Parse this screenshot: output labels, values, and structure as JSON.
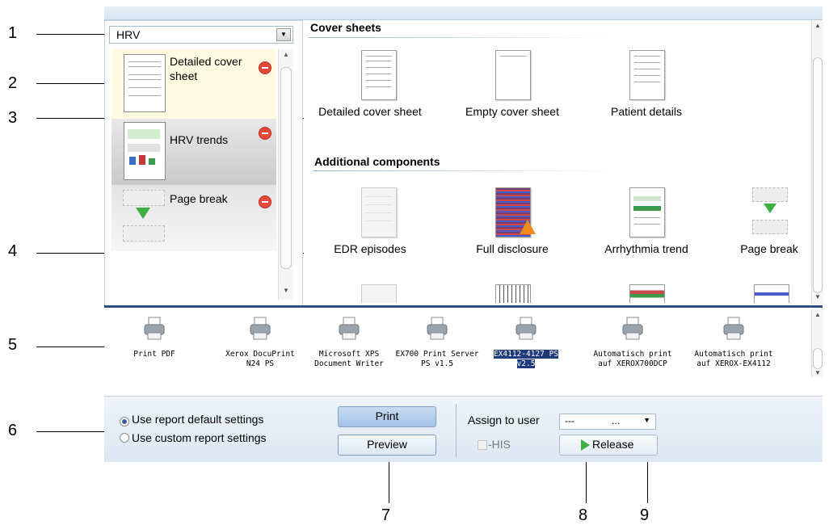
{
  "callouts": [
    "1",
    "2",
    "3",
    "4",
    "5",
    "6",
    "7",
    "8",
    "9"
  ],
  "template_select": {
    "value": "HRV"
  },
  "report_items": [
    {
      "label": "Detailed cover sheet",
      "remove_icon": "remove-icon"
    },
    {
      "label": "HRV trends",
      "remove_icon": "remove-icon"
    },
    {
      "label": "Page break",
      "remove_icon": "remove-icon"
    }
  ],
  "sections": {
    "cover_title": "Cover sheets",
    "additional_title": "Additional components"
  },
  "cover_tiles": [
    "Detailed cover sheet",
    "Empty cover sheet",
    "Patient details"
  ],
  "component_tiles": [
    "EDR episodes",
    "Full disclosure",
    "Arrhythmia trend",
    "Page break"
  ],
  "printers": [
    {
      "line1": "Print PDF",
      "line2": ""
    },
    {
      "line1": "Xerox DocuPrint",
      "line2": "N24 PS"
    },
    {
      "line1": "Microsoft XPS",
      "line2": "Document Writer"
    },
    {
      "line1": "EX700 Print Server",
      "line2": "PS v1.5"
    },
    {
      "line1": "EX4112-4127 PS",
      "line2": "v2.5"
    },
    {
      "line1": "Automatisch print",
      "line2": "auf XEROX700DCP"
    },
    {
      "line1": "Automatisch print",
      "line2": "auf XEROX-EX4112"
    }
  ],
  "settings": {
    "radio_default": "Use report default settings",
    "radio_custom": "Use custom report settings",
    "print_label": "Print",
    "preview_label": "Preview",
    "assign_label": "Assign to user",
    "assign_value_a": "---",
    "assign_value_b": "...",
    "his_label": "-HIS",
    "release_label": "Release"
  },
  "colors": {
    "accent": "#2d4d86",
    "selected_printer": "#1d3a7a",
    "remove": "#e34a3a",
    "release_arrow": "#3cb043"
  }
}
